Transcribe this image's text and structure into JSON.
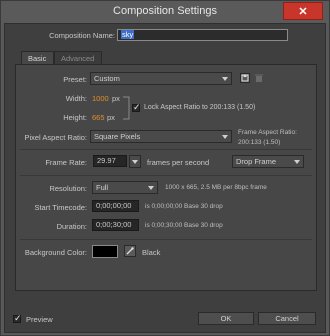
{
  "window": {
    "title": "Composition Settings",
    "close_glyph": "✕"
  },
  "comp_name": {
    "label": "Composition Name:",
    "value": "sky"
  },
  "tabs": [
    {
      "label": "Basic"
    },
    {
      "label": "Advanced"
    }
  ],
  "preset": {
    "label": "Preset:",
    "value": "Custom"
  },
  "width": {
    "label": "Width:",
    "value": "1000",
    "unit": "px"
  },
  "height": {
    "label": "Height:",
    "value": "665",
    "unit": "px"
  },
  "lock_aspect": {
    "checked": true,
    "label": "Lock Aspect Ratio to 200:133 (1.50)"
  },
  "pixel_aspect": {
    "label": "Pixel Aspect Ratio:",
    "value": "Square Pixels"
  },
  "frame_aspect": {
    "label": "Frame Aspect Ratio:",
    "value": "200:133 (1.50)"
  },
  "frame_rate": {
    "label": "Frame Rate:",
    "value": "29.97",
    "unit": "frames per second",
    "drop_value": "Drop Frame"
  },
  "resolution": {
    "label": "Resolution:",
    "value": "Full",
    "info": "1000 x 665, 2.5 MB per 8bpc frame"
  },
  "start_timecode": {
    "label": "Start Timecode:",
    "value": "0;00;00;00",
    "info": "is 0;00;00;00  Base 30  drop"
  },
  "duration": {
    "label": "Duration:",
    "value": "0;00;30;00",
    "info": "is 0;00;30;00  Base 30  drop"
  },
  "background_color": {
    "label": "Background Color:",
    "name": "Black",
    "color": "#000000"
  },
  "preview": {
    "checked": true,
    "label": "Preview"
  },
  "buttons": {
    "ok": "OK",
    "cancel": "Cancel"
  },
  "icons": {
    "save_preset": "save-icon",
    "delete_preset": "trash-icon",
    "eyedropper": "eyedropper-icon"
  }
}
